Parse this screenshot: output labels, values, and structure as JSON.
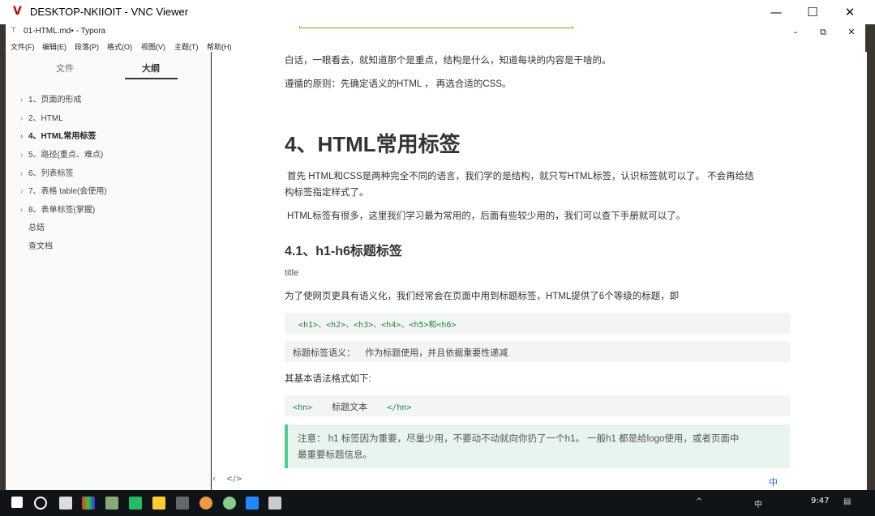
{
  "vnc": {
    "title": "DESKTOP-NKIIOIT - VNC Viewer",
    "logo": "V",
    "minimize": "—",
    "maximize": "☐",
    "close": "✕"
  },
  "typora": {
    "title": "01-HTML.md• - Typora",
    "minimize": "–",
    "restore": "⧉",
    "close": "✕"
  },
  "menu": [
    "文件(F)",
    "编辑(E)",
    "段落(P)",
    "格式(O)",
    "视图(V)",
    "主题(T)",
    "帮助(H)"
  ],
  "sidebar": {
    "tabs": [
      "文件",
      "大纲"
    ],
    "items": [
      {
        "label": "1、页面的形成",
        "chevron": "›"
      },
      {
        "label": "2、HTML",
        "chevron": "›"
      },
      {
        "label": "4、HTML常用标签",
        "chevron": "›",
        "active": true
      },
      {
        "label": "5、路径(重点、难点)",
        "chevron": "›"
      },
      {
        "label": "6、列表标签",
        "chevron": "›"
      },
      {
        "label": "7、表格 table(会使用)",
        "chevron": "›"
      },
      {
        "label": "8、表单标签(掌握)",
        "chevron": "›"
      },
      {
        "label": "总结",
        "chevron": ""
      },
      {
        "label": "查文档",
        "chevron": ""
      }
    ],
    "footer_left": "‹",
    "footer_code": "</>"
  },
  "editor": {
    "p1": "白话，一眼看去，就知道那个是重点，结构是什么，知道每块的内容是干啥的。",
    "p2": "遵循的原则：先确定语义的HTML ， 再选合适的CSS。",
    "h2": "4、HTML常用标签",
    "p3a": "首先 HTML和CSS是两种完全不同的语言，我们学的是结构，就只写HTML标签，认识标签就可以了。 不会再给结",
    "p3b": "构标签指定样式了。",
    "p4": "HTML标签有很多，这里我们学习最为常用的，后面有些较少用的，我们可以查下手册就可以了。",
    "h3": "4.1、h1-h6标题标签",
    "p5": "title",
    "p6": "为了使网页更具有语义化，我们经常会在页面中用到标题标签，HTML提供了6个等级的标题，即",
    "code1": "<h1>、<h2>、<h3>、<h4>、<h5>和<h6>",
    "code2a": "标题标签语义：",
    "code2b": "作为标题使用，并且依据重要性递减",
    "p7": "其基本语法格式如下:",
    "code3a": "<hn>",
    "code3b": "标题文本",
    "code3c": "</hn>",
    "note_l1": "注意： h1 标签因为重要，尽量少用，不要动不动就向你扔了一个h1。 一般h1 都是给logo使用，或者页面中",
    "note_l2": "最重要标题信息。"
  },
  "taskbar": {
    "time": "9:47",
    "ime": "中",
    "tray_text": "中"
  },
  "colors": {
    "accent_green": "#4fcf8d",
    "code_tag": "#22863a"
  }
}
